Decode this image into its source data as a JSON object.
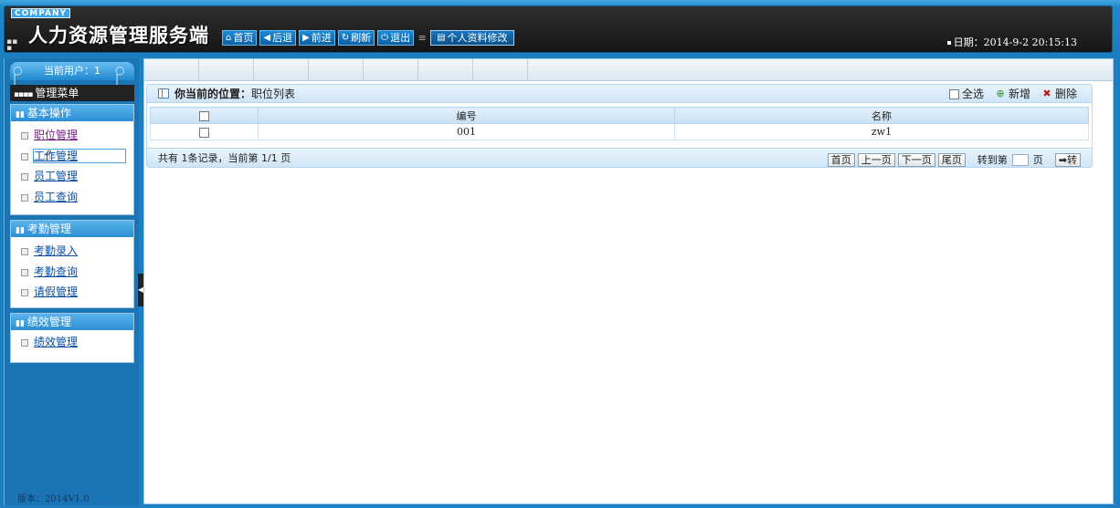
{
  "header": {
    "company": "COMPANY",
    "title": "人力资源管理服务端",
    "nav": [
      {
        "icon": "home-icon",
        "glyph": "⌂",
        "label": "首页"
      },
      {
        "icon": "back-arrow-icon",
        "glyph": "◀",
        "label": "后退"
      },
      {
        "icon": "forward-arrow-icon",
        "glyph": "▶",
        "label": "前进"
      },
      {
        "icon": "refresh-icon",
        "glyph": "↻",
        "label": "刷新"
      },
      {
        "icon": "power-icon",
        "glyph": "⏻",
        "label": "退出"
      }
    ],
    "profile_label": "个人资料修改",
    "date_label": "日期：",
    "date_value": "2014-9-2 20:15:13"
  },
  "sidebar": {
    "current_user_label": "当前用户：",
    "current_user_value": "1",
    "menu_title": "管理菜单",
    "groups": [
      {
        "title": "基本操作",
        "items": [
          "职位管理",
          "工作管理",
          "员工管理",
          "员工查询"
        ]
      },
      {
        "title": "考勤管理",
        "items": [
          "考勤录入",
          "考勤查询",
          "请假管理"
        ]
      },
      {
        "title": "绩效管理",
        "items": [
          "绩效管理"
        ]
      }
    ],
    "version": "版本：2014V1.0"
  },
  "content": {
    "location_label": "你当前的位置：",
    "location_value": "职位列表",
    "toolbar": {
      "select_all": "全选",
      "add": "新增",
      "delete": "删除"
    },
    "table": {
      "columns": [
        "编号",
        "名称"
      ],
      "rows": [
        [
          "001",
          "zw1"
        ]
      ]
    },
    "pager": {
      "info": "共有  1条记录，当前第  1/1 页",
      "first": "首页",
      "prev": "上一页",
      "next": "下一页",
      "last": "尾页",
      "goto_prefix": "转到第",
      "goto_suffix": "页",
      "go": "转"
    }
  },
  "colors": {
    "header_bg": "#1e88c8",
    "accent": "#2a8ed3",
    "link": "#0b4fa6"
  }
}
